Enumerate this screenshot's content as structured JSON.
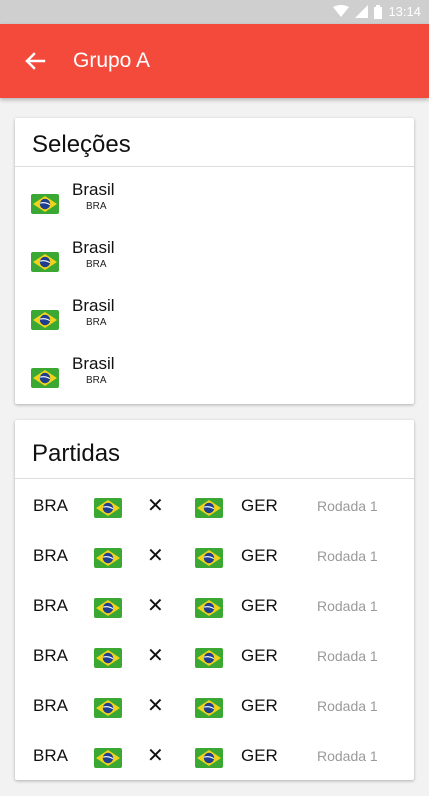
{
  "status_bar": {
    "time": "13:14"
  },
  "app_bar": {
    "title": "Grupo A"
  },
  "teams_card": {
    "title": "Seleções",
    "teams": [
      {
        "name": "Brasil",
        "code": "BRA",
        "flag": "brazil-flag-icon"
      },
      {
        "name": "Brasil",
        "code": "BRA",
        "flag": "brazil-flag-icon"
      },
      {
        "name": "Brasil",
        "code": "BRA",
        "flag": "brazil-flag-icon"
      },
      {
        "name": "Brasil",
        "code": "BRA",
        "flag": "brazil-flag-icon"
      }
    ]
  },
  "matches_card": {
    "title": "Partidas",
    "matches": [
      {
        "home": "BRA",
        "vs": "✕",
        "away": "GER",
        "round": "Rodada 1"
      },
      {
        "home": "BRA",
        "vs": "✕",
        "away": "GER",
        "round": "Rodada 1"
      },
      {
        "home": "BRA",
        "vs": "✕",
        "away": "GER",
        "round": "Rodada 1"
      },
      {
        "home": "BRA",
        "vs": "✕",
        "away": "GER",
        "round": "Rodada 1"
      },
      {
        "home": "BRA",
        "vs": "✕",
        "away": "GER",
        "round": "Rodada 1"
      },
      {
        "home": "BRA",
        "vs": "✕",
        "away": "GER",
        "round": "Rodada 1"
      }
    ]
  },
  "colors": {
    "app_bar": "#f44a3c",
    "flag_green": "#3aa832",
    "flag_yellow": "#f2d31b",
    "flag_blue": "#1e3f8f"
  }
}
